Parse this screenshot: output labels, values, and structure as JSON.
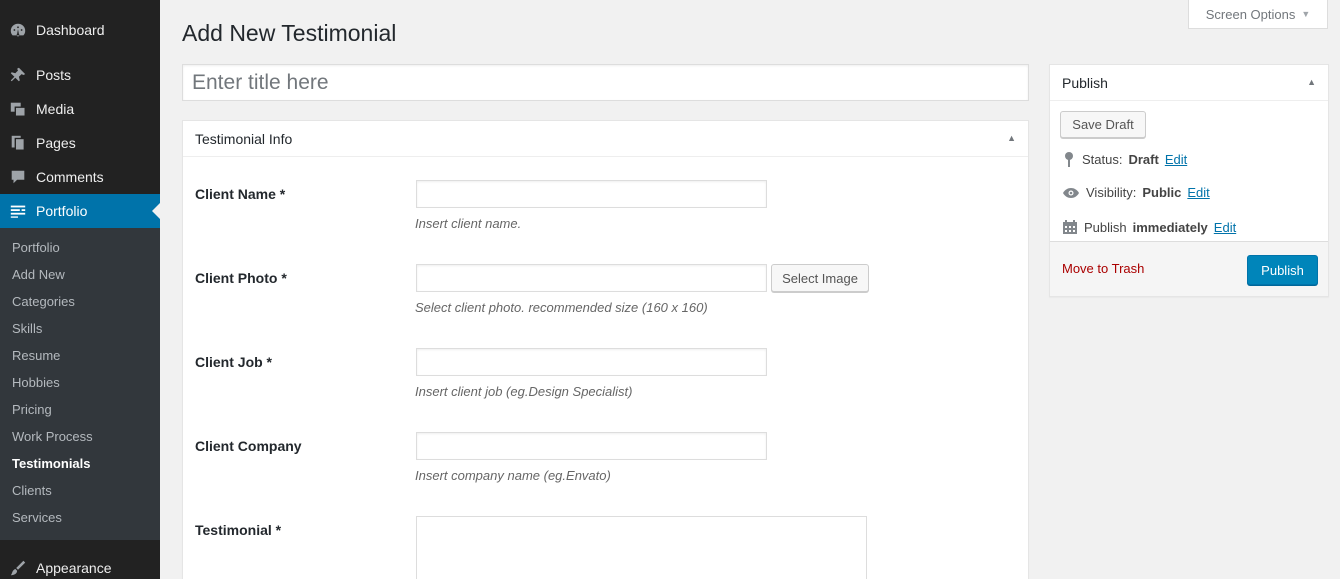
{
  "sidebar": {
    "top_items": [
      {
        "label": "Dashboard",
        "icon": "dashboard-icon"
      },
      {
        "label": "Posts",
        "icon": "pin-icon"
      },
      {
        "label": "Media",
        "icon": "media-icon"
      },
      {
        "label": "Pages",
        "icon": "pages-icon"
      },
      {
        "label": "Comments",
        "icon": "comment-icon"
      },
      {
        "label": "Portfolio",
        "icon": "portfolio-icon"
      }
    ],
    "submenu": [
      "Portfolio",
      "Add New",
      "Categories",
      "Skills",
      "Resume",
      "Hobbies",
      "Pricing",
      "Work Process",
      "Testimonials",
      "Clients",
      "Services"
    ],
    "bottom_item": {
      "label": "Appearance",
      "icon": "brush-icon"
    }
  },
  "screen_options": {
    "label": "Screen Options"
  },
  "page": {
    "title": "Add New Testimonial",
    "title_placeholder": "Enter title here"
  },
  "info_box": {
    "heading": "Testimonial Info",
    "fields": [
      {
        "label": "Client Name *",
        "hint": "Insert client name."
      },
      {
        "label": "Client Photo *",
        "hint": "Select client photo. recommended size (160 x 160)",
        "button": "Select Image"
      },
      {
        "label": "Client Job *",
        "hint": "Insert client job (eg.Design Specialist)"
      },
      {
        "label": "Client Company",
        "hint": "Insert company name (eg.Envato)"
      },
      {
        "label": "Testimonial *"
      }
    ]
  },
  "publish": {
    "heading": "Publish",
    "save_draft": "Save Draft",
    "status_label": "Status:",
    "status_value": "Draft",
    "visibility_label": "Visibility:",
    "visibility_value": "Public",
    "publish_label": "Publish",
    "publish_value": "immediately",
    "edit": "Edit",
    "trash": "Move to Trash",
    "publish_button": "Publish"
  },
  "colors": {
    "accent": "#0073aa",
    "sidebar": "#222222",
    "submenu": "#32373c",
    "publish_button": "#0085ba"
  }
}
